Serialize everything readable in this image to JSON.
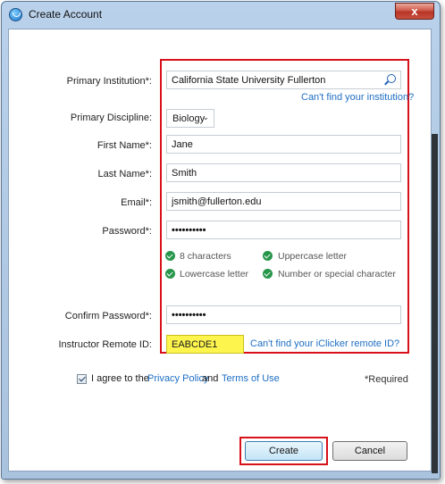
{
  "window": {
    "title": "Create Account",
    "close_label": "x"
  },
  "form": {
    "primary_institution": {
      "label": "Primary Institution*:",
      "value": "California State University Fullerton",
      "help_link": "Can't find your institution?"
    },
    "primary_discipline": {
      "label": "Primary Discipline:",
      "value": "Biology"
    },
    "first_name": {
      "label": "First Name*:",
      "value": "Jane"
    },
    "last_name": {
      "label": "Last Name*:",
      "value": "Smith"
    },
    "email": {
      "label": "Email*:",
      "value": "jsmith@fullerton.edu"
    },
    "password": {
      "label": "Password*:",
      "value": "••••••••••"
    },
    "password_rules": [
      "8 characters",
      "Uppercase letter",
      "Lowercase letter",
      "Number or special character"
    ],
    "confirm_password": {
      "label": "Confirm Password*:",
      "value": "••••••••••"
    },
    "remote_id": {
      "label": "Instructor Remote ID:",
      "value": "EABCDE1",
      "help_link": "Can't find your iClicker remote ID?"
    }
  },
  "agreement": {
    "checked": true,
    "prefix": "I agree to the",
    "privacy_link": "Privacy Policy",
    "and": "and",
    "terms_link": "Terms of Use",
    "required_note": "*Required"
  },
  "buttons": {
    "create": "Create",
    "cancel": "Cancel"
  },
  "colors": {
    "highlight": "#d8101a",
    "link": "#1e6fc4",
    "remote_field": "#fdf44e",
    "rule_check": "#27964b"
  }
}
